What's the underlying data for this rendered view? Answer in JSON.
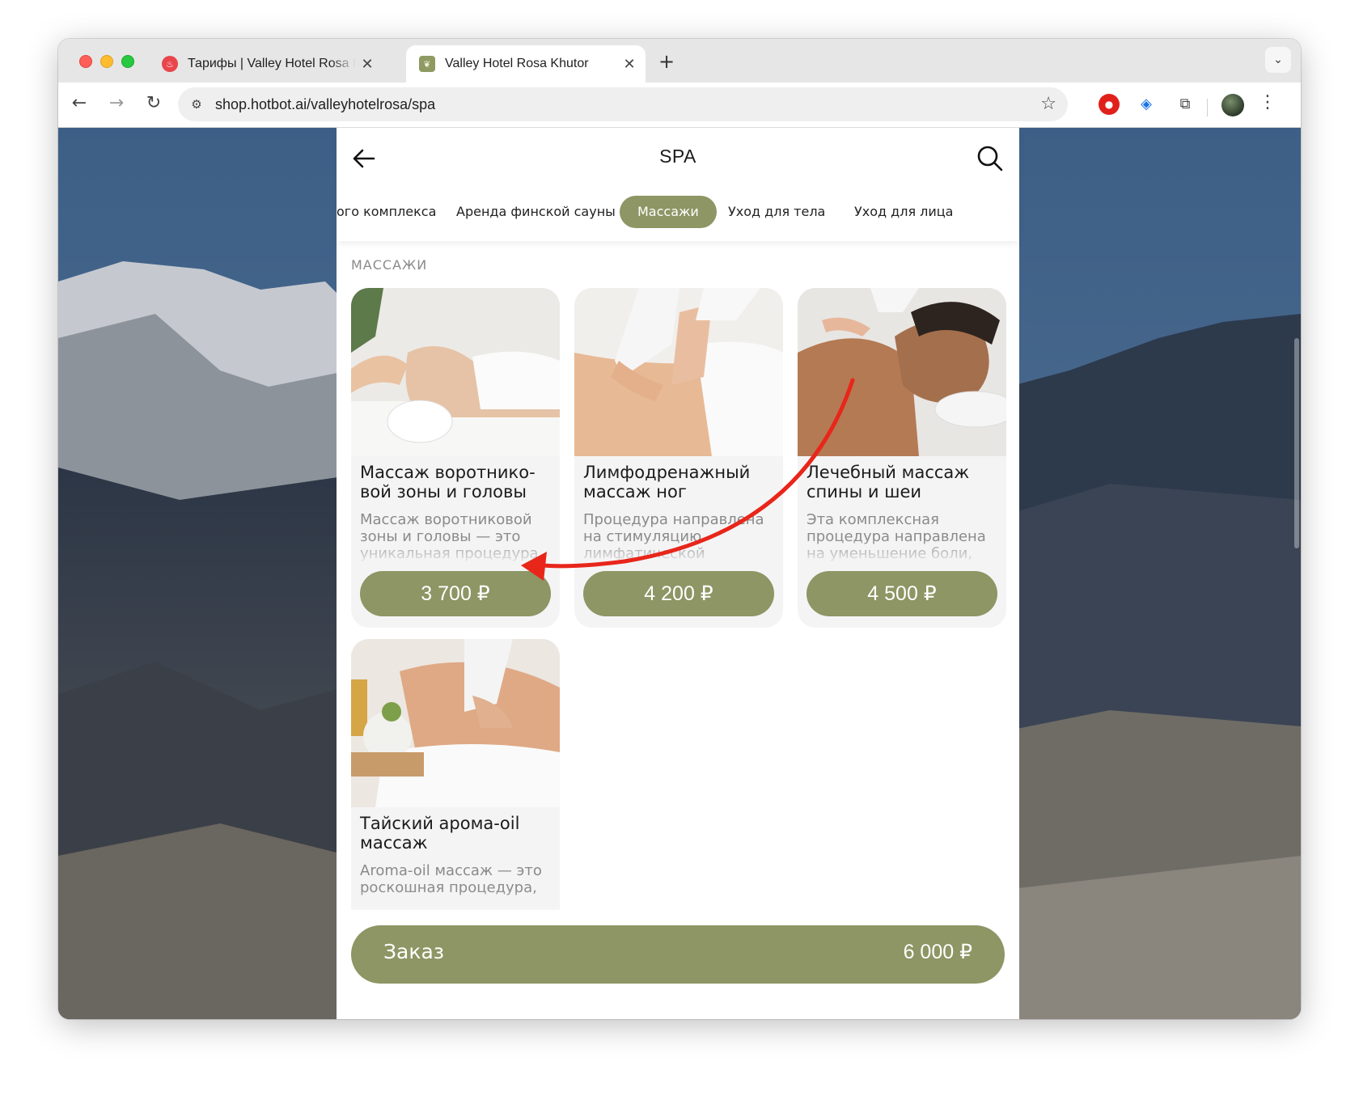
{
  "browser": {
    "tabs": [
      {
        "title": "Тарифы | Valley Hotel Rosa Khutor",
        "icon": "flame-favicon"
      },
      {
        "title": "Valley Hotel Rosa Khutor",
        "icon": "hotel-logo-favicon"
      }
    ],
    "new_tab_label": "+",
    "url": "shop.hotbot.ai/valleyhotelrosa/spa"
  },
  "app": {
    "title": "SPA",
    "categories": [
      {
        "label": "ого комплекса",
        "active": false
      },
      {
        "label": "Аренда финской сауны",
        "active": false
      },
      {
        "label": "Массажи",
        "active": true
      },
      {
        "label": "Уход для тела",
        "active": false
      },
      {
        "label": "Уход для лица",
        "active": false
      }
    ],
    "section_title": "МАССАЖИ",
    "products": [
      {
        "name": "Массаж воротнико-\nвой зоны и головы",
        "description": "Массаж воротниковой зоны и головы — это уникальная процедура,",
        "price": "3 700 ₽"
      },
      {
        "name": "Лимфодренажный\nмассаж ног",
        "description": "Процедура направлена на стимуляцию лимфатической",
        "price": "4 200 ₽"
      },
      {
        "name": "Лечебный массаж спины и шеи",
        "description": "Эта комплексная процедура направлена на уменьшение боли,",
        "price": "4 500 ₽"
      },
      {
        "name": "Тайский арома-oil\nмассаж",
        "description": "Aroma-oil массаж — это роскошная процедура,",
        "price": ""
      }
    ],
    "order": {
      "label": "Заказ",
      "total": "6 000 ₽"
    }
  },
  "colors": {
    "accent": "#8d9664",
    "annotation_arrow": "#e8261a"
  }
}
